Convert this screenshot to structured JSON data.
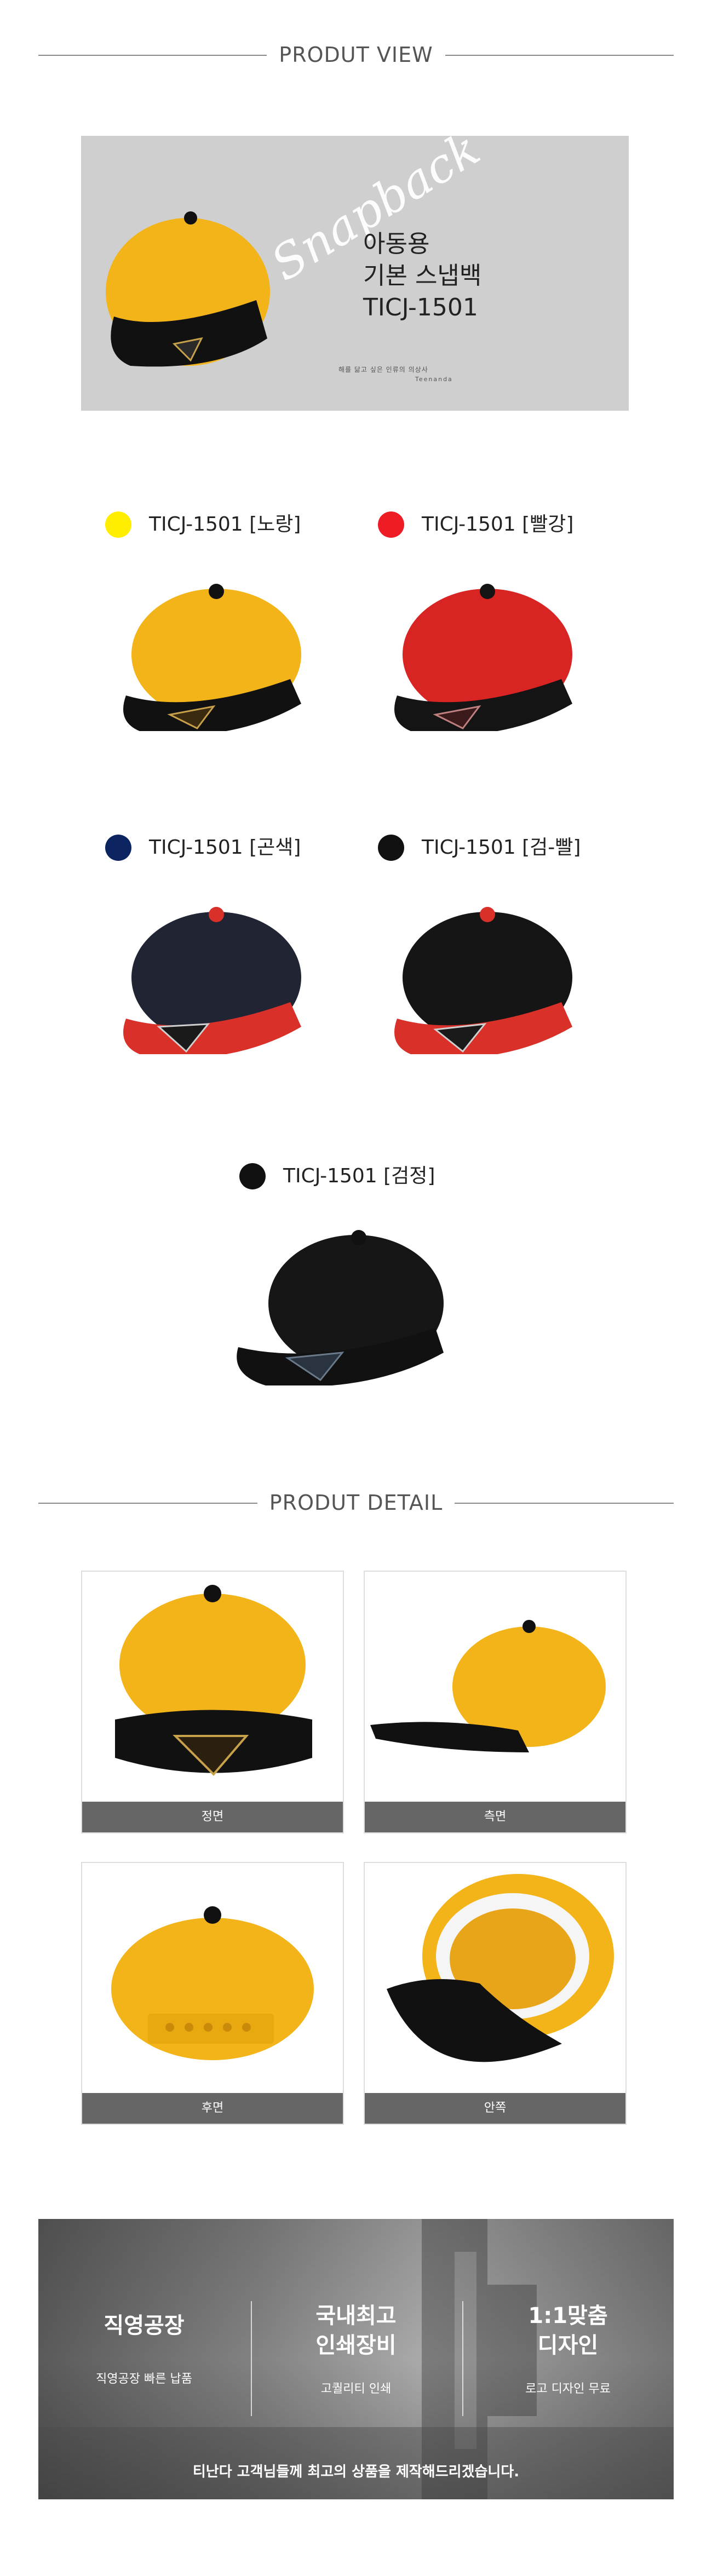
{
  "sections": {
    "view_title": "PRODUT VIEW",
    "detail_title": "PRODUT DETAIL"
  },
  "hero": {
    "script_text": "Snapback",
    "line1": "아동용",
    "line2": "기본 스냅백",
    "line3": "TICJ-1501",
    "tagline": "해를 닮고 싶은 인류의 의상사",
    "brand": "Teenanda"
  },
  "colors": [
    {
      "label": "TICJ-1501 [노랑]",
      "dot": "#ffee00",
      "crown": "#f2b418",
      "visor": "#111111",
      "button": "#111111"
    },
    {
      "label": "TICJ-1501 [빨강]",
      "dot": "#ee1c24",
      "crown": "#d92424",
      "visor": "#141414",
      "button": "#141414"
    },
    {
      "label": "TICJ-1501 [곤색]",
      "dot": "#0c2461",
      "crown": "#202433",
      "visor": "#d9302a",
      "button": "#d9302a"
    },
    {
      "label": "TICJ-1501 [검-빨]",
      "dot": "#111111",
      "crown": "#151515",
      "visor": "#d9302a",
      "button": "#d9302a"
    },
    {
      "label": "TICJ-1501 [검정]",
      "dot": "#111111",
      "crown": "#161616",
      "visor": "#111111",
      "button": "#111111"
    }
  ],
  "details": [
    {
      "caption": "정면"
    },
    {
      "caption": "측면"
    },
    {
      "caption": "후면"
    },
    {
      "caption": "안쪽"
    }
  ],
  "factory": {
    "col1_title": "직영공장",
    "col1_sub": "직영공장 빠른 납품",
    "col2_title_line1": "국내최고",
    "col2_title_line2": "인쇄장비",
    "col2_sub": "고퀄리티 인쇄",
    "col3_title_line1": "1:1맞춤",
    "col3_title_line2": "디자인",
    "col3_sub": "로고 디자인 무료",
    "bottom_text": "티난다 고객님들께 최고의 상품을 제작해드리겠습니다."
  }
}
